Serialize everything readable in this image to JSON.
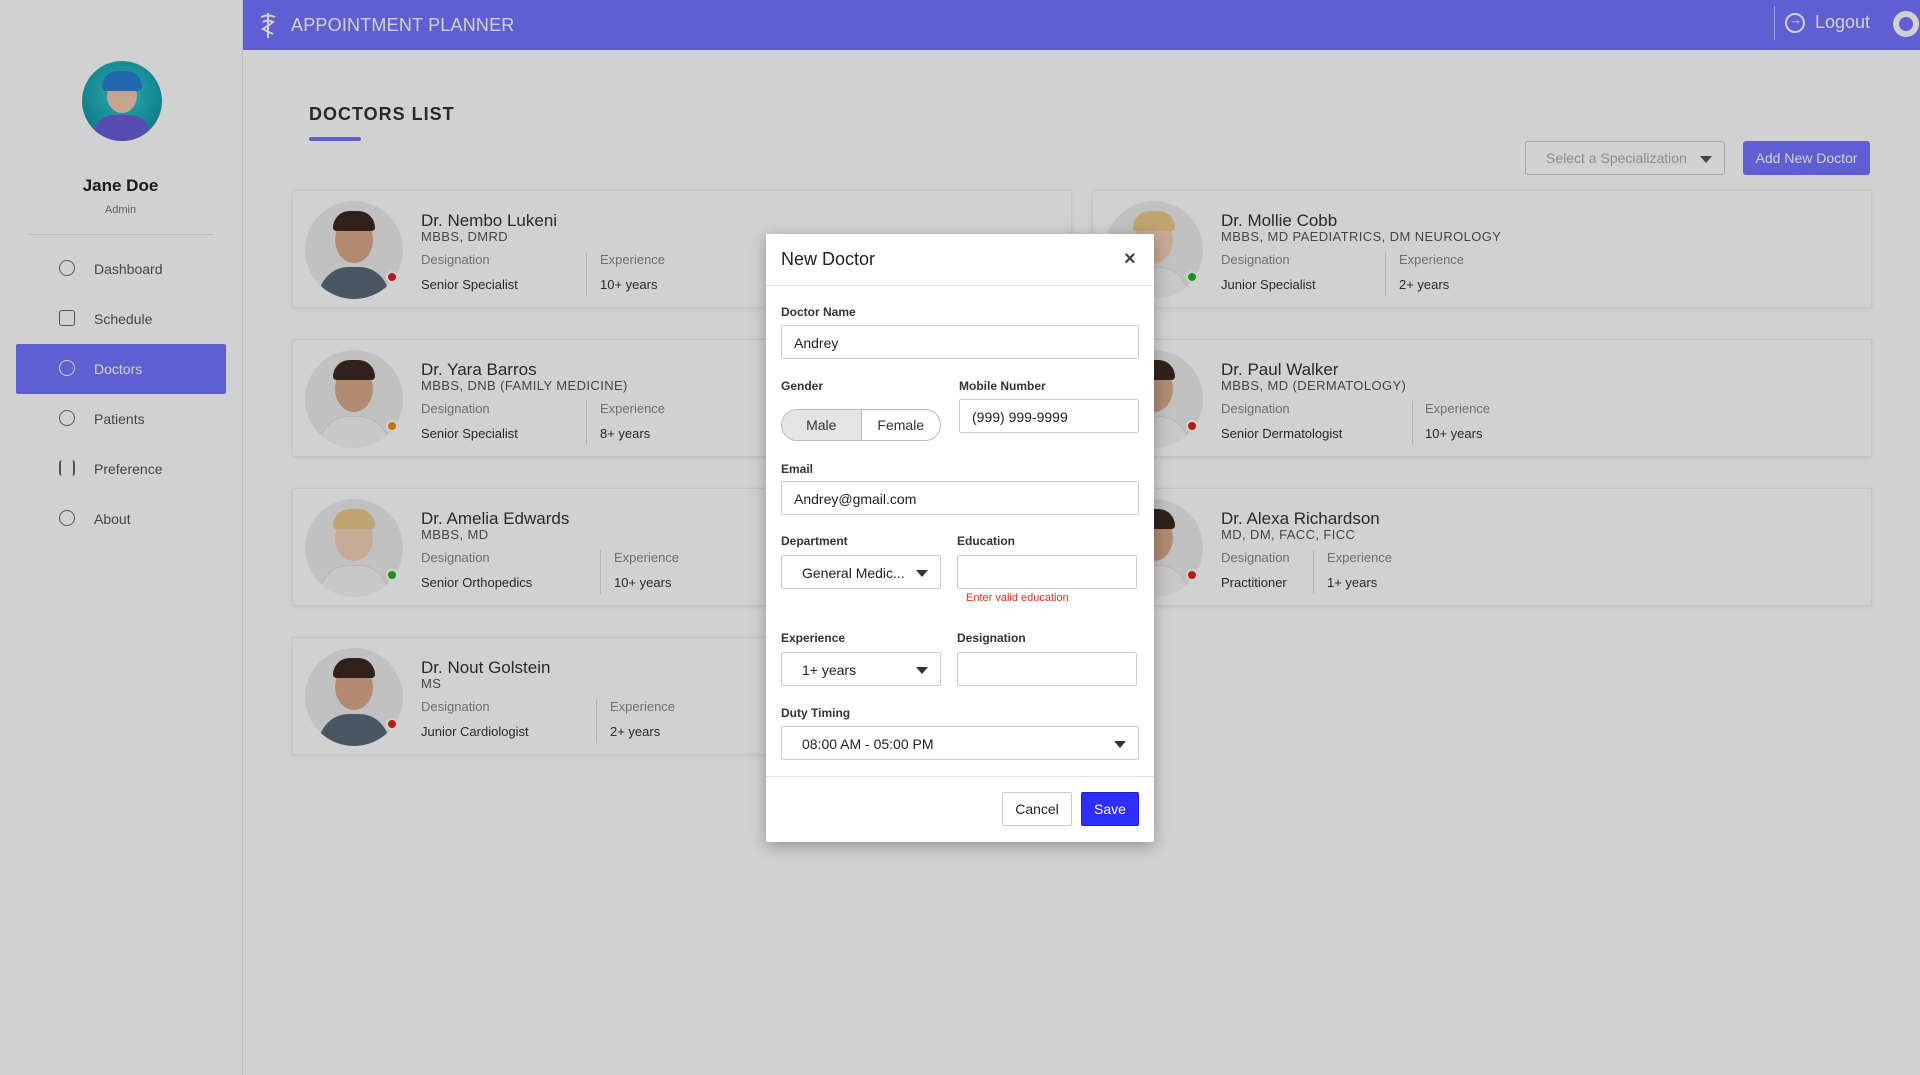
{
  "header": {
    "title": "APPOINTMENT PLANNER",
    "logout_label": "Logout",
    "logo_icon": "caduceus-icon",
    "github_icon": "github-icon"
  },
  "sidebar": {
    "user_name": "Jane Doe",
    "user_role": "Admin",
    "items": [
      {
        "label": "Dashboard",
        "icon": "gauge-icon"
      },
      {
        "label": "Schedule",
        "icon": "calendar-icon"
      },
      {
        "label": "Doctors",
        "icon": "stethoscope-icon",
        "active": true
      },
      {
        "label": "Patients",
        "icon": "patients-icon"
      },
      {
        "label": "Preference",
        "icon": "sliders-icon"
      },
      {
        "label": "About",
        "icon": "info-icon"
      }
    ]
  },
  "main": {
    "page_title": "DOCTORS LIST",
    "spec_placeholder": "Select a Specialization",
    "add_button": "Add New Doctor",
    "designation_label": "Designation",
    "experience_label": "Experience",
    "doctors": [
      {
        "name": "Dr. Nembo Lukeni",
        "education": "MBBS, DMRD",
        "designation": "Senior Specialist",
        "experience": "10+ years",
        "status_color": "#e02020"
      },
      {
        "name": "Dr. Mollie Cobb",
        "education": "MBBS, MD PAEDIATRICS, DM NEUROLOGY",
        "designation": "Junior Specialist",
        "experience": "2+ years",
        "status_color": "#22b422"
      },
      {
        "name": "Dr. Yara Barros",
        "education": "MBBS, DNB (FAMILY MEDICINE)",
        "designation": "Senior Specialist",
        "experience": "8+ years",
        "status_color": "#f08c1e"
      },
      {
        "name": "Dr. Paul Walker",
        "education": "MBBS, MD (DERMATOLOGY)",
        "designation": "Senior Dermatologist",
        "experience": "10+ years",
        "status_color": "#e02020"
      },
      {
        "name": "Dr. Amelia Edwards",
        "education": "MBBS, MD",
        "designation": "Senior Orthopedics",
        "experience": "10+ years",
        "status_color": "#22b422"
      },
      {
        "name": "Dr. Alexa Richardson",
        "education": "MD, DM, FACC, FICC",
        "designation": "Practitioner",
        "experience": "1+ years",
        "status_color": "#e02020"
      },
      {
        "name": "Dr. Nout Golstein",
        "education": "MS",
        "designation": "Junior Cardiologist",
        "experience": "2+ years",
        "status_color": "#e02020"
      }
    ]
  },
  "modal": {
    "title": "New Doctor",
    "doctor_name_label": "Doctor Name",
    "doctor_name_value": "Andrey",
    "gender_label": "Gender",
    "gender_male": "Male",
    "gender_female": "Female",
    "mobile_label": "Mobile Number",
    "mobile_value": "(999) 999-9999",
    "email_label": "Email",
    "email_value": "Andrey@gmail.com",
    "department_label": "Department",
    "department_value": "General Medic...",
    "education_label": "Education",
    "education_value": "",
    "education_error": "Enter valid education",
    "experience_label": "Experience",
    "experience_value": "1+ years",
    "designation_label": "Designation",
    "designation_value": "",
    "duty_label": "Duty Timing",
    "duty_value": "08:00 AM - 05:00 PM",
    "cancel_label": "Cancel",
    "save_label": "Save"
  },
  "colors": {
    "accent": "#7575ff",
    "save": "#2e2eff",
    "error": "#e0301e"
  }
}
